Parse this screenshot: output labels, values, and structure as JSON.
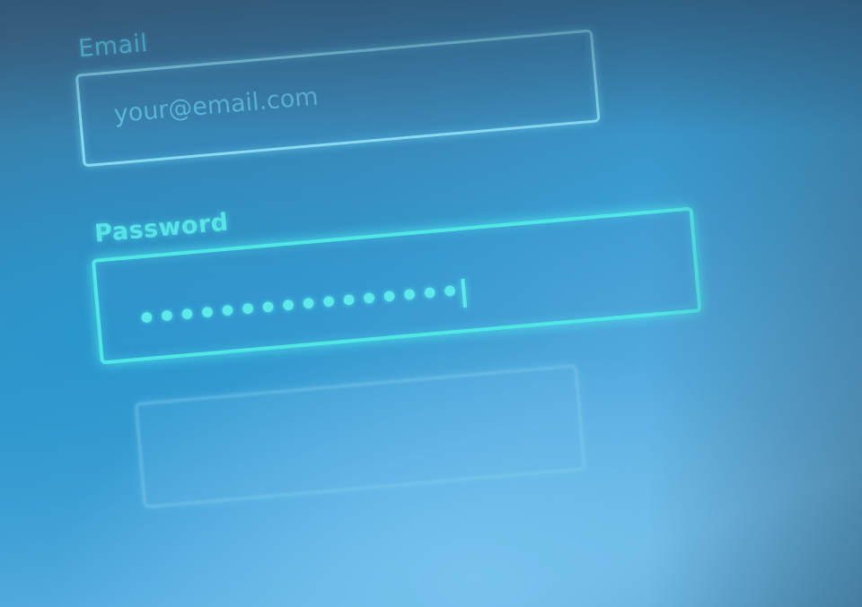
{
  "form": {
    "email": {
      "label": "Email",
      "placeholder": "your@email.com"
    },
    "password": {
      "label": "Password",
      "masked_value": "••••••••••••••••"
    },
    "submit": {
      "label": ""
    }
  },
  "colors": {
    "accent_cyan": "#51e6e6",
    "email_label": "#5fd3f2",
    "background_blue": "#3a9bd0"
  }
}
